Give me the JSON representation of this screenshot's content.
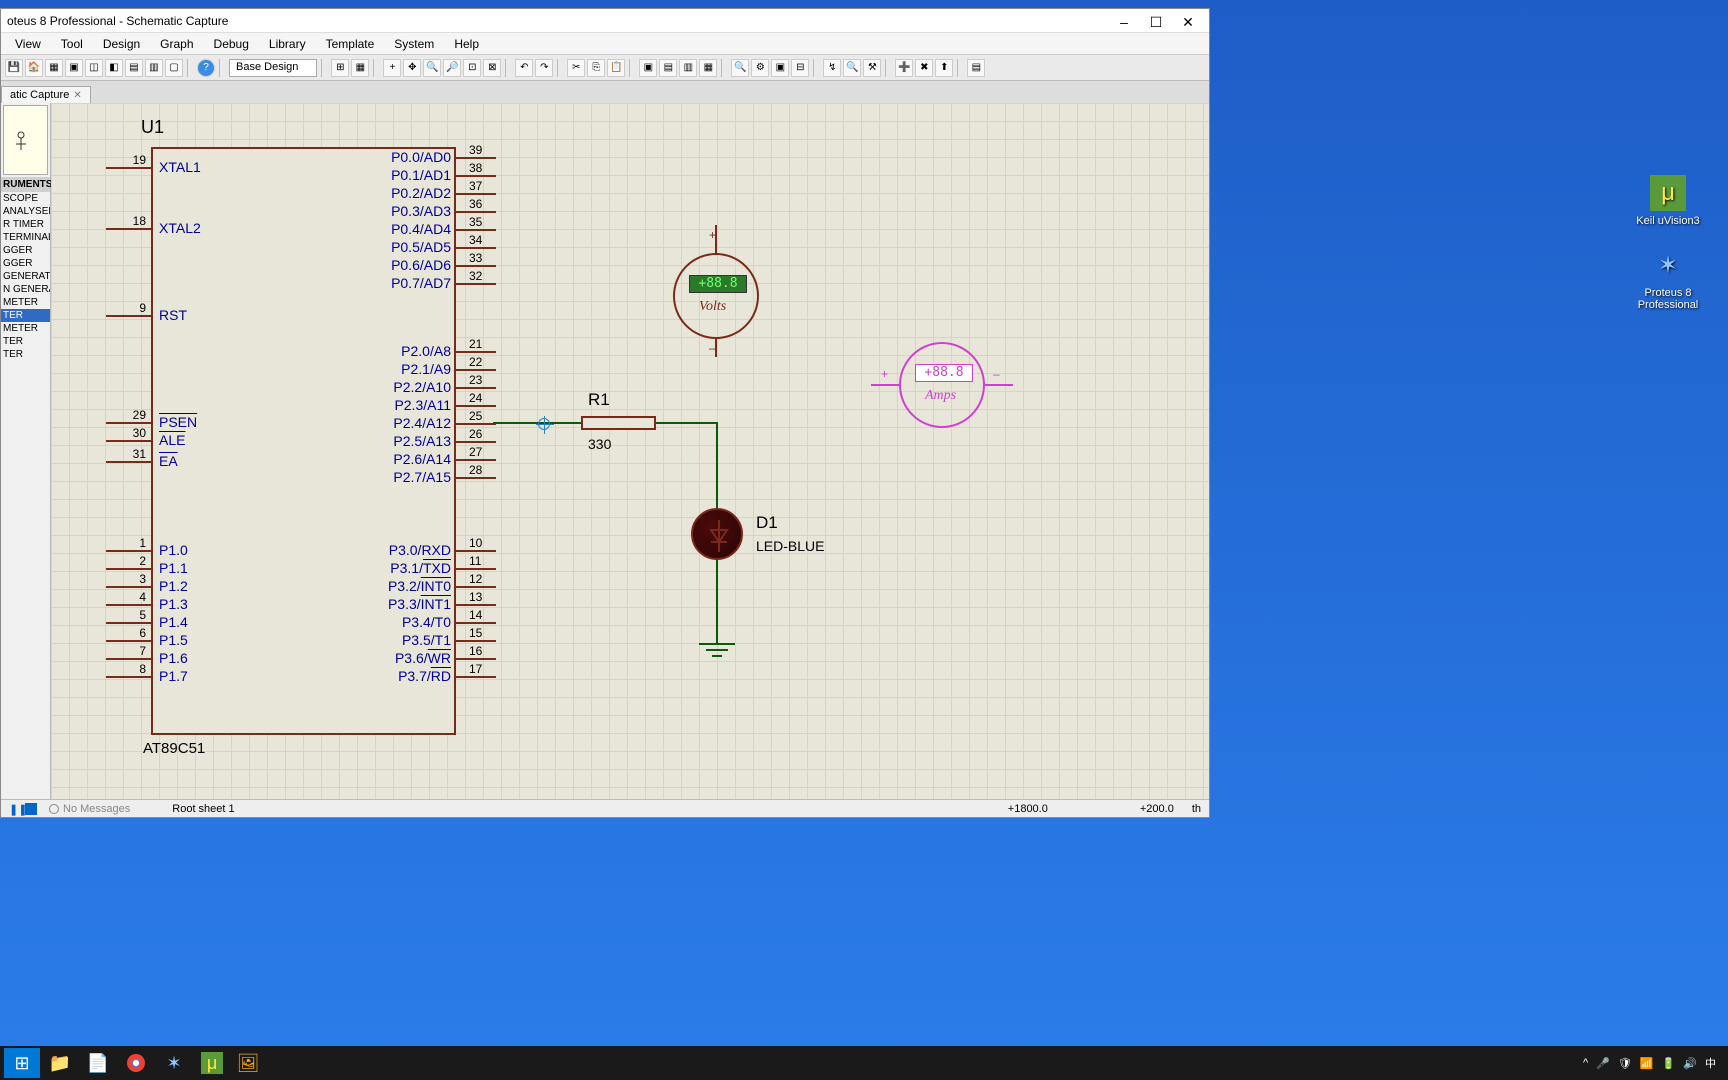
{
  "titlebar": {
    "title": "oteus 8 Professional - Schematic Capture"
  },
  "menu": [
    "View",
    "Tool",
    "Design",
    "Graph",
    "Debug",
    "Library",
    "Template",
    "System",
    "Help"
  ],
  "toolbar": {
    "design_dropdown": "Base Design"
  },
  "tab": {
    "label": "atic Capture"
  },
  "sidebar": {
    "header": "RUMENTS",
    "items": [
      "SCOPE",
      "ANALYSER",
      "R TIMER",
      "TERMINAL",
      "GGER",
      "GGER",
      "GENERATOR",
      "N GENERATO",
      "METER",
      "TER",
      "METER",
      "TER",
      "TER"
    ],
    "selected_index": 9
  },
  "schematic": {
    "chip": {
      "ref": "U1",
      "model": "AT89C51",
      "left_pins": [
        {
          "num": "19",
          "label": "XTAL1"
        },
        {
          "num": "18",
          "label": "XTAL2"
        },
        {
          "num": "9",
          "label": "RST"
        },
        {
          "num": "29",
          "label": "PSEN",
          "overline": true
        },
        {
          "num": "30",
          "label": "ALE",
          "overline": true
        },
        {
          "num": "31",
          "label": "EA",
          "overline": true
        },
        {
          "num": "1",
          "label": "P1.0"
        },
        {
          "num": "2",
          "label": "P1.1"
        },
        {
          "num": "3",
          "label": "P1.2"
        },
        {
          "num": "4",
          "label": "P1.3"
        },
        {
          "num": "5",
          "label": "P1.4"
        },
        {
          "num": "6",
          "label": "P1.5"
        },
        {
          "num": "7",
          "label": "P1.6"
        },
        {
          "num": "8",
          "label": "P1.7"
        }
      ],
      "right_pins": [
        {
          "num": "39",
          "label": "P0.0/AD0"
        },
        {
          "num": "38",
          "label": "P0.1/AD1"
        },
        {
          "num": "37",
          "label": "P0.2/AD2"
        },
        {
          "num": "36",
          "label": "P0.3/AD3"
        },
        {
          "num": "35",
          "label": "P0.4/AD4"
        },
        {
          "num": "34",
          "label": "P0.5/AD5"
        },
        {
          "num": "33",
          "label": "P0.6/AD6"
        },
        {
          "num": "32",
          "label": "P0.7/AD7"
        },
        {
          "num": "21",
          "label": "P2.0/A8"
        },
        {
          "num": "22",
          "label": "P2.1/A9"
        },
        {
          "num": "23",
          "label": "P2.2/A10"
        },
        {
          "num": "24",
          "label": "P2.3/A11"
        },
        {
          "num": "25",
          "label": "P2.4/A12"
        },
        {
          "num": "26",
          "label": "P2.5/A13"
        },
        {
          "num": "27",
          "label": "P2.6/A14"
        },
        {
          "num": "28",
          "label": "P2.7/A15"
        },
        {
          "num": "10",
          "label": "P3.0/RXD"
        },
        {
          "num": "11",
          "label": "P3.1/TXD",
          "overline_part": "TXD"
        },
        {
          "num": "12",
          "label": "P3.2/INT0",
          "overline_part": "INT0"
        },
        {
          "num": "13",
          "label": "P3.3/INT1",
          "overline_part": "INT1"
        },
        {
          "num": "14",
          "label": "P3.4/T0"
        },
        {
          "num": "15",
          "label": "P3.5/T1"
        },
        {
          "num": "16",
          "label": "P3.6/WR",
          "overline_part": "WR"
        },
        {
          "num": "17",
          "label": "P3.7/RD",
          "overline_part": "RD"
        }
      ]
    },
    "resistor": {
      "ref": "R1",
      "value": "330"
    },
    "led": {
      "ref": "D1",
      "value": "LED-BLUE"
    },
    "voltmeter": {
      "reading": "+88.8",
      "unit": "Volts"
    },
    "ammeter": {
      "reading": "+88.8",
      "unit": "Amps"
    }
  },
  "statusbar": {
    "messages": "No Messages",
    "sheet": "Root sheet 1",
    "coord1": "+1800.0",
    "coord2": "+200.0",
    "unit": "th"
  },
  "desktop": {
    "icons": [
      {
        "name": "Keil uVision3"
      },
      {
        "name": "Proteus 8 Professional"
      }
    ]
  },
  "systray": {
    "ime": "中"
  }
}
